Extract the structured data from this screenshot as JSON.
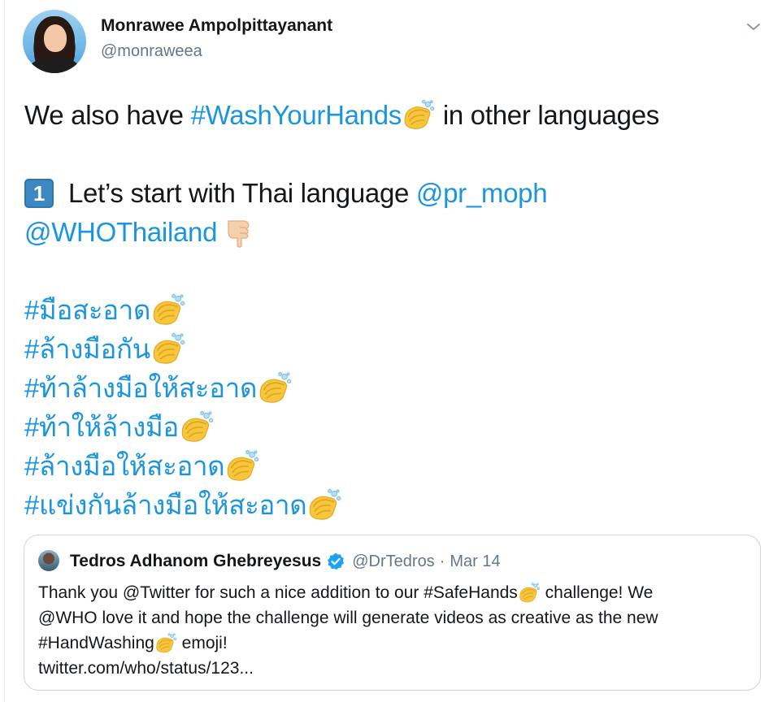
{
  "author": {
    "name": "Monrawee Ampolpittayanant",
    "handle": "@monraweea"
  },
  "icons": {
    "caret": "chevron-down-icon",
    "wash": "washing-hands-emoji",
    "point": "backhand-index-pointing-down-emoji",
    "keycap": "keycap-one-emoji",
    "verified": "verified-badge-icon"
  },
  "colors": {
    "link": "#1b95e0",
    "text": "#14171a",
    "muted": "#657786",
    "border": "#ccd6dd",
    "verified": "#1da1f2"
  },
  "tweet": {
    "line1": {
      "prefix": "We also have ",
      "hashtag": "#WashYourHands",
      "suffix": " in other languages"
    },
    "line2": {
      "keycap": "1",
      "text": "Let’s start with Thai language ",
      "mention1": "@pr_moph",
      "mention2": "@WHOThailand"
    },
    "thai_hashtags": [
      "#มือสะอาด",
      "#ล้างมือกัน",
      "#ท้าล้างมือให้สะอาด",
      "#ท้าให้ล้างมือ",
      "#ล้างมือให้สะอาด",
      "#แข่งกันล้างมือให้สะอาด"
    ]
  },
  "quote": {
    "name": "Tedros Adhanom Ghebreyesus",
    "handle": "@DrTedros",
    "separator": "·",
    "date": "Mar 14",
    "row1_a": "Thank you @Twitter for such a nice addition to our #SafeHands",
    "row1_b": " challenge! We",
    "row2": "@WHO love it and hope the challenge will generate videos as creative as the new",
    "row3_a": "#HandWashing",
    "row3_b": " emoji!",
    "row4": "twitter.com/who/status/123..."
  }
}
